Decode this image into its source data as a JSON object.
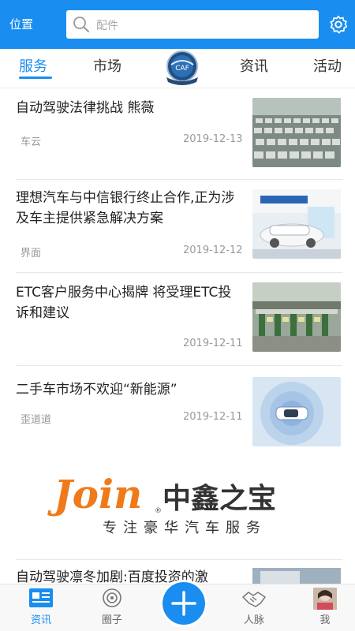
{
  "header": {
    "location": "位置",
    "search_placeholder": "配件"
  },
  "tabs": [
    {
      "label": "服务",
      "active": true
    },
    {
      "label": "市场",
      "active": false
    },
    {
      "label": "资讯",
      "active": false
    },
    {
      "label": "活动",
      "active": false
    }
  ],
  "logo_text": "CAF",
  "news": [
    {
      "title": "自动驾驶法律挑战 熊薇",
      "source": "车云",
      "date": "2019-12-13",
      "thumb": "parking-lot-cars"
    },
    {
      "title": "理想汽车与中信银行终止合作,正为涉及车主提供紧急解决方案",
      "source": "界面",
      "date": "2019-12-12",
      "thumb": "car-showroom"
    },
    {
      "title": "ETC客户服务中心揭牌 将受理ETC投诉和建议",
      "source": "",
      "date": "2019-12-11",
      "thumb": "toll-station"
    },
    {
      "title": "二手车市场不欢迎“新能源”",
      "source": "歪道道",
      "date": "2019-12-11",
      "thumb": "sensor-car"
    }
  ],
  "banner": {
    "brand_en": "Join",
    "brand_cn": "中鑫之宝",
    "slogan": "专注豪华汽车服务",
    "registered": "®"
  },
  "peek_title": "自动驾驶凛冬加剧:百度投资的激",
  "bottom_nav": [
    {
      "label": "资讯",
      "icon": "news-icon",
      "active": true
    },
    {
      "label": "圈子",
      "icon": "circle-icon",
      "active": false
    },
    {
      "label": "人脉",
      "icon": "handshake-icon",
      "active": false
    },
    {
      "label": "我",
      "icon": "avatar",
      "active": false
    }
  ],
  "colors": {
    "accent": "#1a8ef0",
    "brand_orange": "#f07a1a",
    "brand_dark": "#333333"
  }
}
